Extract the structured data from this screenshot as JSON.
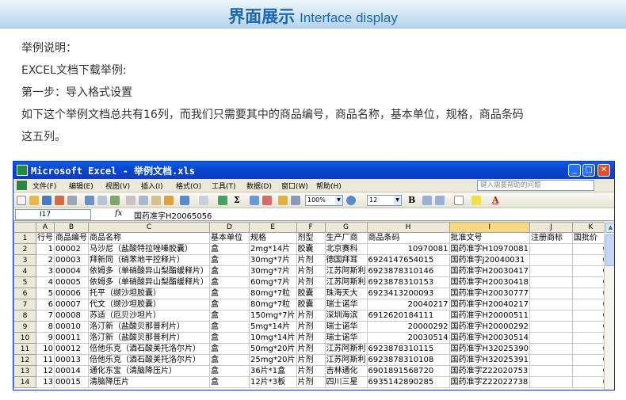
{
  "banner": {
    "title_cn": "界面展示",
    "title_en": "Interface display"
  },
  "description": [
    "举例说明：",
    "EXCEL文档下载举例:",
    "第一步：导入格式设置",
    "如下这个举例文档总共有16列，而我们只需要其中的商品编号，商品名称，基本单位，规格，商品条码",
    "这五列。"
  ],
  "window": {
    "title": "Microsoft Excel - 举例文档.xls",
    "menu": [
      "文件(F)",
      "编辑(E)",
      "视图(V)",
      "插入(I)",
      "格式(O)",
      "工具(T)",
      "数据(D)",
      "窗口(W)",
      "帮助(H)"
    ],
    "help_placeholder": "键入需要帮助的问题",
    "zoom": "100%",
    "font_size": "12",
    "name_box": "I17",
    "fx_label": "fx",
    "formula": "国药准字H20065056",
    "selected_column": "I"
  },
  "columns": [
    "A",
    "B",
    "C",
    "D",
    "E",
    "F",
    "G",
    "H",
    "I",
    "J",
    "K"
  ],
  "rows": [
    {
      "n": "1",
      "cells": [
        "行号",
        "商品编号",
        "商品名称",
        "基本单位",
        "规格",
        "剂型",
        "生产厂商",
        "商品条码",
        "批准文号",
        "注册商标",
        "国批价"
      ]
    },
    {
      "n": "2",
      "cells": [
        "1",
        "00002",
        "马沙尼（盐酸特拉唑嗪胶囊）",
        "盒",
        "2mg*14片",
        "胶囊",
        "北京赛科",
        "10970081",
        "国药准字H10970081",
        "",
        "0"
      ]
    },
    {
      "n": "3",
      "cells": [
        "2",
        "00003",
        "拜新同（硝苯地平控释片）",
        "盒",
        "30mg*7片",
        "片剂",
        "德国拜耳",
        "6924147654015",
        "国药准字J20040031",
        "",
        "0"
      ]
    },
    {
      "n": "4",
      "cells": [
        "3",
        "00004",
        "依姆多（单硝酸异山梨酯缓释片）",
        "盒",
        "30mg*7片",
        "片剂",
        "江苏阿斯利",
        "6923878310146",
        "国药准字H20030417",
        "",
        "0"
      ]
    },
    {
      "n": "5",
      "cells": [
        "4",
        "00005",
        "依姆多（单硝酸异山梨酯缓释片）",
        "盒",
        "60mg*7片",
        "片剂",
        "江苏阿斯利",
        "6923878310153",
        "国药准字H20030418",
        "",
        "0"
      ]
    },
    {
      "n": "6",
      "cells": [
        "5",
        "00006",
        "托平（缬沙坦胶囊）",
        "盒",
        "80mg*7粒",
        "胶囊",
        "珠海天大",
        "6923413200093",
        "国药准字H20030777",
        "",
        "0"
      ]
    },
    {
      "n": "7",
      "cells": [
        "6",
        "00007",
        "代文（缬沙坦胶囊）",
        "盒",
        "80mg*7粒",
        "胶囊",
        "瑞士诺华",
        "20040217",
        "国药准字H20040217",
        "",
        "0"
      ]
    },
    {
      "n": "8",
      "cells": [
        "7",
        "00008",
        "苏适（厄贝沙坦片）",
        "盒",
        "150mg*7片",
        "片剂",
        "深圳海滨",
        "6912620184111",
        "国药准字H20000511",
        "",
        "0"
      ]
    },
    {
      "n": "9",
      "cells": [
        "8",
        "00010",
        "洛汀新（盐酸贝那普利片）",
        "盒",
        "5mg*14片",
        "片剂",
        "瑞士诺华",
        "20000292",
        "国药准字H20000292",
        "",
        "0"
      ]
    },
    {
      "n": "10",
      "cells": [
        "9",
        "00011",
        "洛汀新（盐酸贝那普利片）",
        "盒",
        "10mg*14片",
        "片剂",
        "瑞士诺华",
        "20030514",
        "国药准字H20030514",
        "",
        "0"
      ]
    },
    {
      "n": "11",
      "cells": [
        "10",
        "00012",
        "倍他乐克（酒石酸美托洛尔片）",
        "盒",
        "50mg*20片",
        "片剂",
        "江苏阿斯利",
        "6923878310115",
        "国药准字H32025390",
        "",
        "0"
      ]
    },
    {
      "n": "12",
      "cells": [
        "11",
        "00013",
        "倍他乐克（酒石酸美托洛尔片）",
        "盒",
        "25mg*20片",
        "片剂",
        "江苏阿斯利",
        "6923878310108",
        "国药准字H32025391",
        "",
        "0"
      ]
    },
    {
      "n": "13",
      "cells": [
        "12",
        "00014",
        "通化东宝（清脑降压片）",
        "盒",
        "36片*1盒",
        "片剂",
        "吉林通化",
        "6901891568720",
        "国药准字Z22020753",
        "",
        "0"
      ]
    },
    {
      "n": "14",
      "cells": [
        "13",
        "00015",
        "清脑降压片",
        "盒",
        "12片*3板",
        "片剂",
        "四川三星",
        "6935142890285",
        "国药准字Z22022738",
        "",
        "0"
      ]
    }
  ],
  "colors": {
    "banner_text": "#1b67b2",
    "titlebar": "#0a46d0",
    "selected_header": "#f8d880"
  }
}
